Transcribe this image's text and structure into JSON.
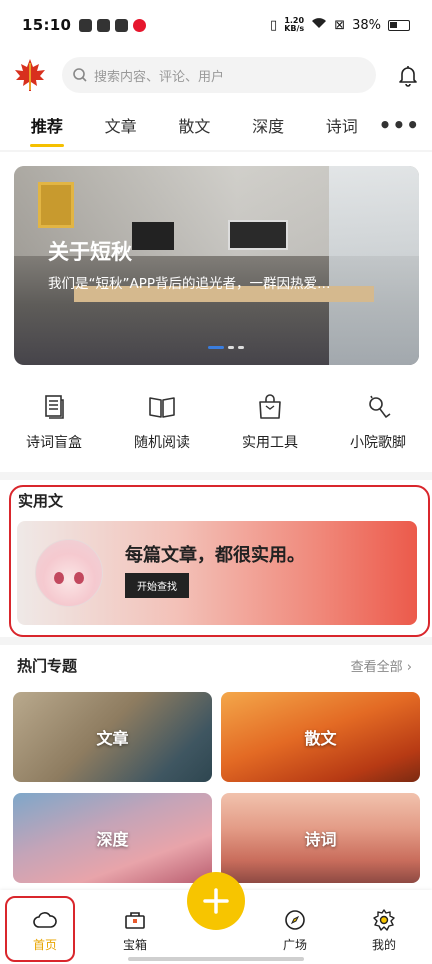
{
  "status_bar": {
    "time": "15:10",
    "net_speed_value": "1.20",
    "net_speed_unit": "KB/s",
    "battery": "38%"
  },
  "header": {
    "logo_icon": "maple-leaf-icon",
    "search_placeholder": "搜索内容、评论、用户",
    "notification_icon": "bell-icon"
  },
  "tabs": {
    "items": [
      "推荐",
      "文章",
      "散文",
      "深度",
      "诗词"
    ],
    "active": "推荐",
    "more_label": "•••"
  },
  "banner": {
    "title": "关于短秋",
    "desc": "我们是“短秋”APP背后的追光者，一群因热爱…"
  },
  "quick_actions": [
    {
      "label": "诗词盲盒",
      "icon": "document-list-icon"
    },
    {
      "label": "随机阅读",
      "icon": "open-book-icon"
    },
    {
      "label": "实用工具",
      "icon": "shopping-bag-icon"
    },
    {
      "label": "小院歌脚",
      "icon": "search-person-icon"
    }
  ],
  "practical": {
    "title": "实用文",
    "headline": "每篇文章，都很实用。",
    "button": "开始查找"
  },
  "hot_topics": {
    "title": "热门专题",
    "view_all": "查看全部 ›",
    "items": [
      "文章",
      "散文",
      "深度",
      "诗词"
    ]
  },
  "bottom_nav": {
    "items": [
      "首页",
      "宝箱",
      "广场",
      "我的"
    ],
    "active": "首页",
    "fab_icon": "plus-icon"
  },
  "colors": {
    "accent": "#f7c500",
    "active_tab_underline": "#f5c000",
    "highlight_ring": "#d9262c"
  }
}
